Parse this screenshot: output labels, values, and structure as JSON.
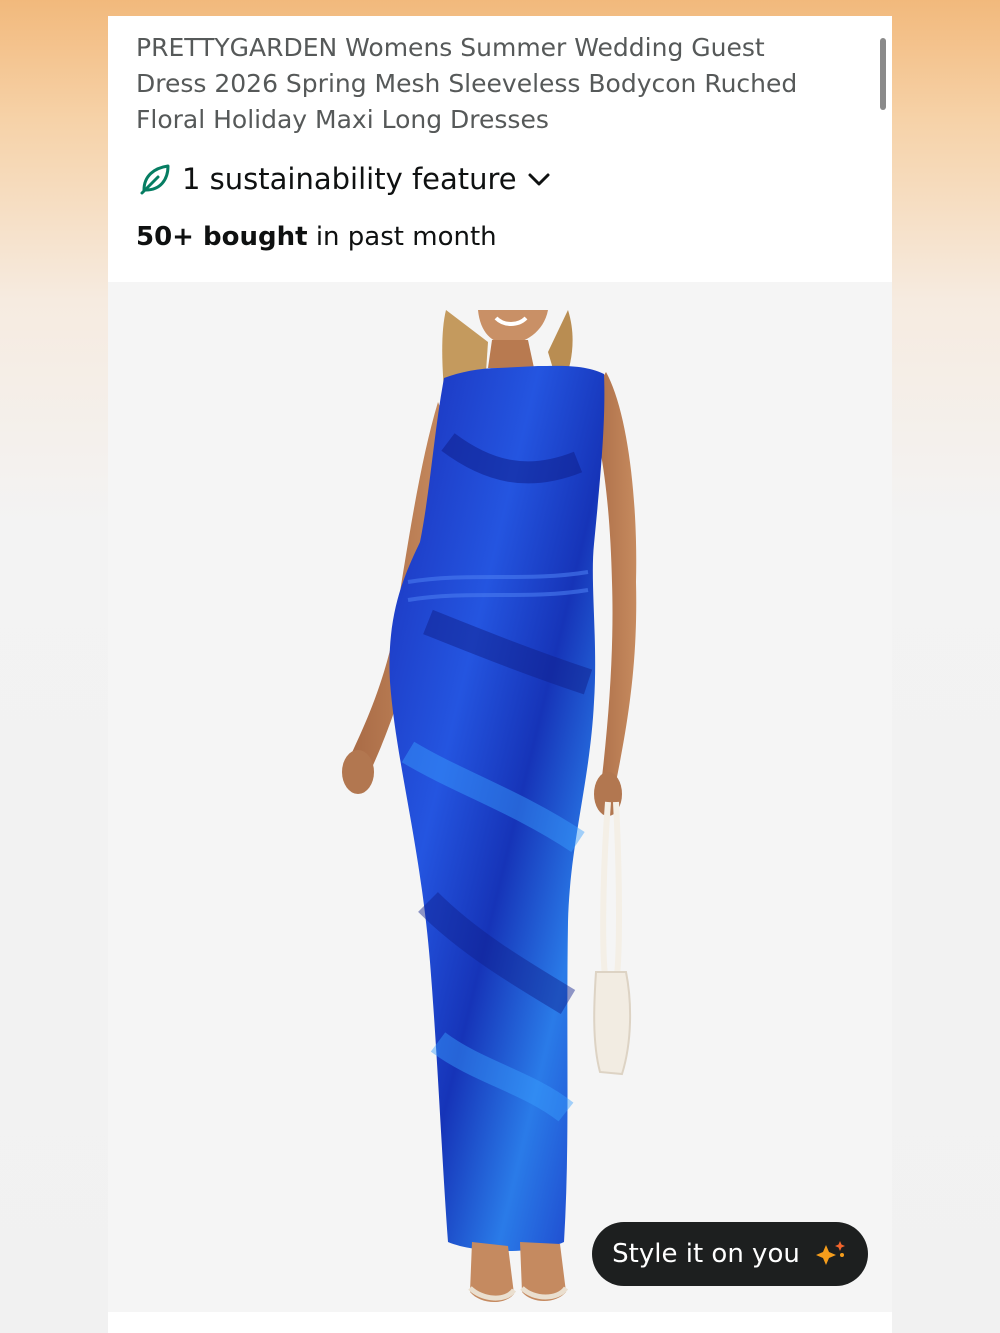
{
  "product": {
    "title": "PRETTYGARDEN Womens Summer Wedding Guest Dress 2026 Spring Mesh Sleeveless Bodycon Ruched Floral Holiday Maxi Long Dresses",
    "sustainability_label": "1 sustainability feature",
    "bought_count": "50+ bought",
    "bought_suffix": " in past month"
  },
  "gallery": {
    "image_alt": "Woman wearing a blue sleeveless bodycon maxi dress holding a white handbag"
  },
  "actions": {
    "style_it_label": "Style it on you"
  },
  "icons": {
    "sustainability": "leaf-icon",
    "expand": "chevron-down-icon",
    "sparkle": "sparkle-icon"
  },
  "colors": {
    "leaf": "#067d62",
    "dress": "#1e3fd0",
    "button_bg": "#1d1f1f",
    "sparkle": "#f59d1c"
  }
}
